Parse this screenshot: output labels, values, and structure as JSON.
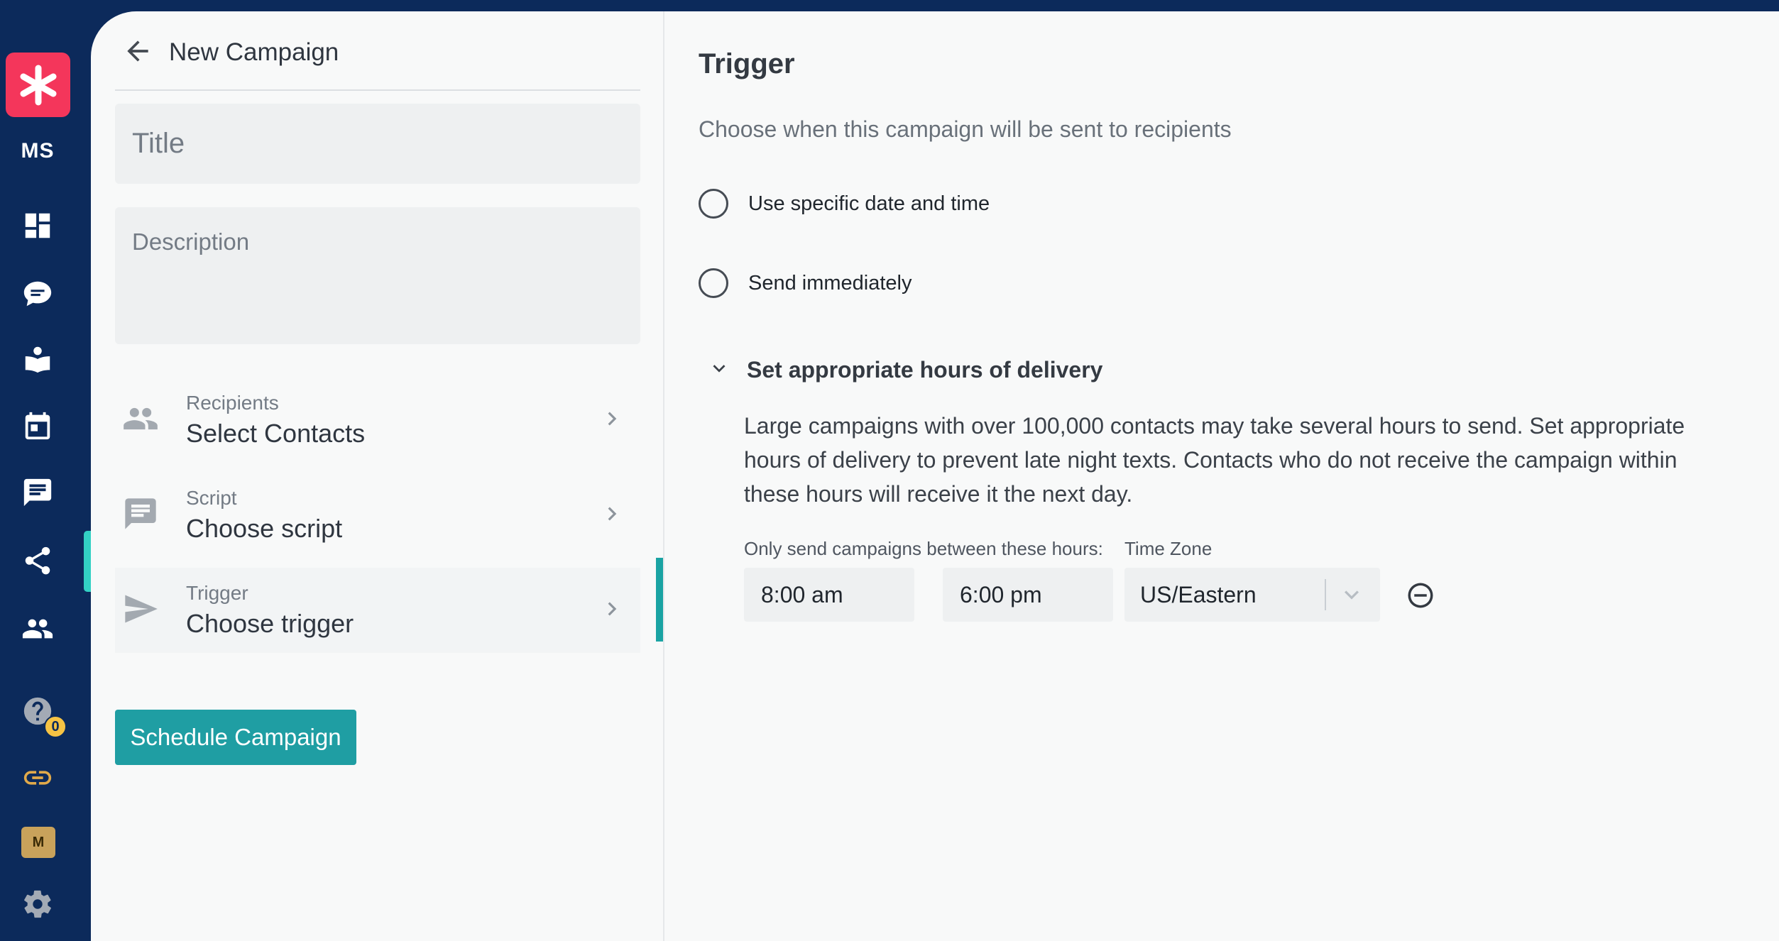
{
  "rail": {
    "initials": "MS",
    "icons": [
      "dashboard-icon",
      "chat-bubbles-icon",
      "reader-icon",
      "calendar-icon",
      "message-icon",
      "campaigns-share-icon",
      "contacts-people-icon",
      "help-icon",
      "link-icon",
      "settings-gear-icon"
    ],
    "help_badge_count": "0",
    "org_badge": "M",
    "accent_color": "#33d1c4",
    "brand_color": "#f4365b"
  },
  "header": {
    "title": "New Campaign"
  },
  "form": {
    "title_placeholder": "Title",
    "description_placeholder": "Description"
  },
  "steps": [
    {
      "label": "Recipients",
      "value": "Select Contacts",
      "icon": "people-icon"
    },
    {
      "label": "Script",
      "value": "Choose script",
      "icon": "message-icon"
    },
    {
      "label": "Trigger",
      "value": "Choose trigger",
      "icon": "send-icon"
    }
  ],
  "actions": {
    "schedule_label": "Schedule Campaign",
    "primary_color": "#1f9ea3"
  },
  "trigger": {
    "title": "Trigger",
    "subtitle": "Choose when this campaign will be sent to recipients",
    "options": [
      {
        "label": "Use specific date and time",
        "selected": false
      },
      {
        "label": "Send immediately",
        "selected": false
      }
    ],
    "delivery": {
      "heading": "Set appropriate hours of delivery",
      "body": "Large campaigns with over 100,000 contacts may take several hours to send. Set appropriate hours of delivery to prevent late night texts. Contacts who do not receive the campaign within these hours will receive it the next day.",
      "hours_label": "Only send campaigns between these hours:",
      "timezone_label": "Time Zone",
      "start_time": "8:00 am",
      "separator": "-",
      "end_time": "6:00 pm",
      "timezone": "US/Eastern"
    }
  }
}
